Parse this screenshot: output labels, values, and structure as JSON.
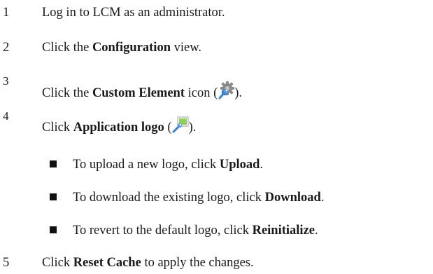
{
  "steps": [
    {
      "num": "1",
      "pre": "Log in to LCM as an administrator.",
      "bold": "",
      "post": ""
    },
    {
      "num": "2",
      "pre": "Click the ",
      "bold": "Configuration",
      "post": " view."
    },
    {
      "num": "3",
      "pre": "Click the ",
      "bold": "Custom Element",
      "post": " icon (",
      "icon": "custom-element-gear-wrench-icon",
      "close": ")."
    },
    {
      "num": "4",
      "pre": "Click ",
      "bold": "Application logo",
      "post": " (",
      "icon": "application-logo-icon",
      "close": ")."
    },
    {
      "num": "5",
      "pre": "Click ",
      "bold": "Reset Cache",
      "post": " to apply the changes."
    }
  ],
  "bullets": [
    {
      "pre": "To upload a new logo, click ",
      "bold": "Upload",
      "post": "."
    },
    {
      "pre": "To download the existing logo, click ",
      "bold": "Download",
      "post": "."
    },
    {
      "pre": "To revert to the default logo, click ",
      "bold": "Reinitialize",
      "post": "."
    }
  ],
  "colors": {
    "text": "#1a1a1a",
    "icon_gear": "#8a8a8a",
    "icon_wrench": "#3a7fd0",
    "icon_logo_green": "#8ed05a"
  }
}
